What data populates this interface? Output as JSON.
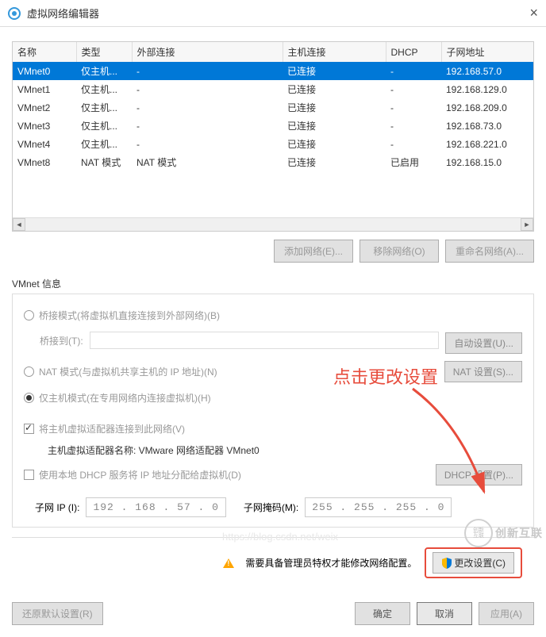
{
  "window": {
    "title": "虚拟网络编辑器",
    "close": "×"
  },
  "table": {
    "headers": [
      "名称",
      "类型",
      "外部连接",
      "主机连接",
      "DHCP",
      "子网地址"
    ],
    "rows": [
      {
        "name": "VMnet0",
        "type": "仅主机...",
        "ext": "-",
        "host": "已连接",
        "dhcp": "-",
        "subnet": "192.168.57.0",
        "selected": true
      },
      {
        "name": "VMnet1",
        "type": "仅主机...",
        "ext": "-",
        "host": "已连接",
        "dhcp": "-",
        "subnet": "192.168.129.0"
      },
      {
        "name": "VMnet2",
        "type": "仅主机...",
        "ext": "-",
        "host": "已连接",
        "dhcp": "-",
        "subnet": "192.168.209.0"
      },
      {
        "name": "VMnet3",
        "type": "仅主机...",
        "ext": "-",
        "host": "已连接",
        "dhcp": "-",
        "subnet": "192.168.73.0"
      },
      {
        "name": "VMnet4",
        "type": "仅主机...",
        "ext": "-",
        "host": "已连接",
        "dhcp": "-",
        "subnet": "192.168.221.0"
      },
      {
        "name": "VMnet8",
        "type": "NAT 模式",
        "ext": "NAT 模式",
        "host": "已连接",
        "dhcp": "已启用",
        "subnet": "192.168.15.0"
      }
    ]
  },
  "buttons": {
    "add_network": "添加网络(E)...",
    "remove_network": "移除网络(O)",
    "rename_network": "重命名网络(A)...",
    "auto_settings": "自动设置(U)...",
    "nat_settings": "NAT 设置(S)...",
    "dhcp_settings": "DHCP 设置(P)...",
    "restore_defaults": "还原默认设置(R)",
    "ok": "确定",
    "cancel": "取消",
    "apply": "应用(A)",
    "change_settings": "更改设置(C)"
  },
  "vmnet_info": {
    "section_title": "VMnet 信息",
    "bridge_mode": "桥接模式(将虚拟机直接连接到外部网络)(B)",
    "bridge_to": "桥接到(T):",
    "nat_mode": "NAT 模式(与虚拟机共享主机的 IP 地址)(N)",
    "host_only": "仅主机模式(在专用网络内连接虚拟机)(H)",
    "connect_adapter": "将主机虚拟适配器连接到此网络(V)",
    "adapter_name": "主机虚拟适配器名称: VMware 网络适配器 VMnet0",
    "use_dhcp": "使用本地 DHCP 服务将 IP 地址分配给虚拟机(D)",
    "subnet_ip_label": "子网 IP (I):",
    "subnet_ip": "192 . 168 . 57 .  0",
    "subnet_mask_label": "子网掩码(M):",
    "subnet_mask": "255 . 255 . 255 .  0"
  },
  "footer": {
    "admin_msg": "需要具备管理员特权才能修改网络配置。"
  },
  "annotation": "点击更改设置",
  "url_watermark": "https://blog.csdn.net/weix",
  "logo": "创新互联"
}
